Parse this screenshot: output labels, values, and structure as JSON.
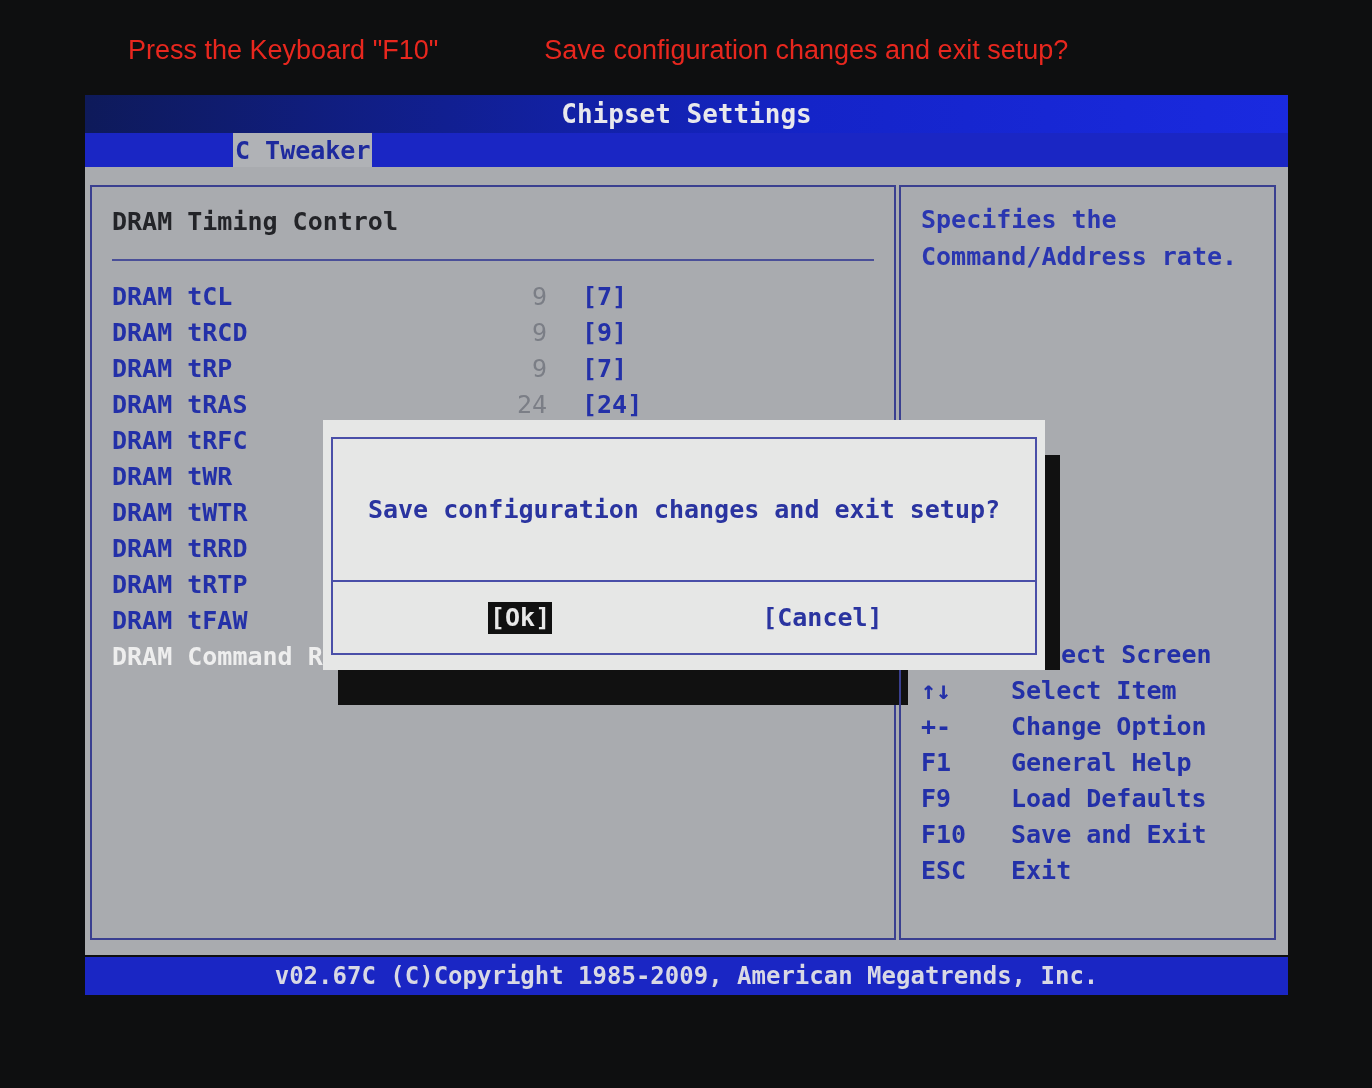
{
  "annotations": [
    "Press the Keyboard \"F10\"",
    "Save configuration  changes and exit setup?"
  ],
  "window": {
    "title": "Chipset Settings"
  },
  "tabs": [
    {
      "label": "C Tweaker",
      "selected": true
    }
  ],
  "section": {
    "title": "DRAM Timing Control"
  },
  "items": [
    {
      "name": "DRAM tCL",
      "default": "9",
      "value": "[7]",
      "selected": false
    },
    {
      "name": "DRAM tRCD",
      "default": "9",
      "value": "[9]",
      "selected": false
    },
    {
      "name": "DRAM tRP",
      "default": "9",
      "value": "[7]",
      "selected": false
    },
    {
      "name": "DRAM tRAS",
      "default": "24",
      "value": "[24]",
      "selected": false
    },
    {
      "name": "DRAM tRFC",
      "selected": false
    },
    {
      "name": "DRAM tWR",
      "selected": false
    },
    {
      "name": "DRAM tWTR",
      "selected": false
    },
    {
      "name": "DRAM tRRD",
      "selected": false
    },
    {
      "name": "DRAM tRTP",
      "selected": false
    },
    {
      "name": "DRAM tFAW",
      "selected": false
    },
    {
      "name": "DRAM Command R",
      "selected": true
    }
  ],
  "help": {
    "description": "Specifies the Command/Address rate.",
    "keys": [
      {
        "text": "ect Screen"
      },
      {
        "key": "↑↓",
        "text": "Select Item"
      },
      {
        "key": "+-",
        "text": "Change Option"
      },
      {
        "key": "F1",
        "text": "General Help"
      },
      {
        "key": "F9",
        "text": "Load Defaults"
      },
      {
        "key": "F10",
        "text": "Save and Exit"
      },
      {
        "key": "ESC",
        "text": "Exit"
      }
    ]
  },
  "dialog": {
    "message": "Save configuration changes and exit setup?",
    "buttons": [
      {
        "label": "[Ok]",
        "selected": true
      },
      {
        "label": "[Cancel]",
        "selected": false
      }
    ]
  },
  "status_bar": "v02.67C (C)Copyright 1985-2009, American Megatrends, Inc."
}
